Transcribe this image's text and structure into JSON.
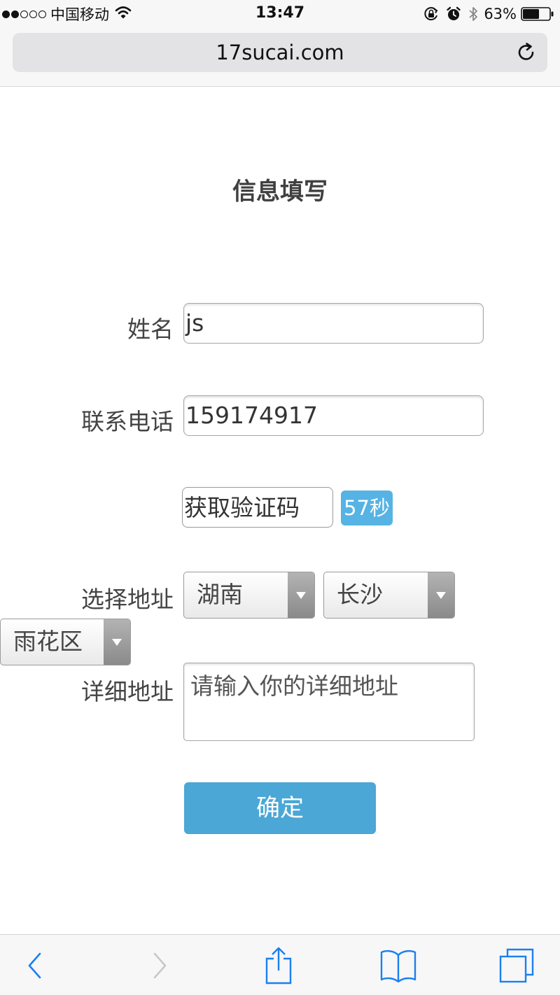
{
  "status_bar": {
    "signal_dots": [
      true,
      true,
      false,
      false,
      false
    ],
    "carrier": "中国移动",
    "time": "13:47",
    "battery_percent": "63%",
    "battery_level": 0.63,
    "icons": [
      "wifi-icon",
      "orientation-lock-icon",
      "alarm-icon",
      "bluetooth-icon",
      "battery-icon"
    ]
  },
  "browser": {
    "url": "17sucai.com",
    "reload_icon": "reload-icon"
  },
  "form": {
    "title": "信息填写",
    "name_label": "姓名",
    "name_value": "js",
    "phone_label": "联系电话",
    "phone_value": "159174917",
    "code_button": "获取验证码",
    "countdown": "57秒",
    "address_label": "选择地址",
    "province": "湖南",
    "city": "长沙",
    "district": "雨花区",
    "detail_label": "详细地址",
    "detail_placeholder": "请输入你的详细地址",
    "submit": "确定"
  },
  "toolbar": {
    "items": [
      "back-icon",
      "forward-icon",
      "share-icon",
      "bookmarks-icon",
      "tabs-icon"
    ]
  },
  "colors": {
    "accent": "#4aa7d6",
    "countdown_bg": "#56b3e4",
    "toolbar_icon": "#1a7ff0",
    "toolbar_icon_disabled": "#c7c7cc"
  }
}
